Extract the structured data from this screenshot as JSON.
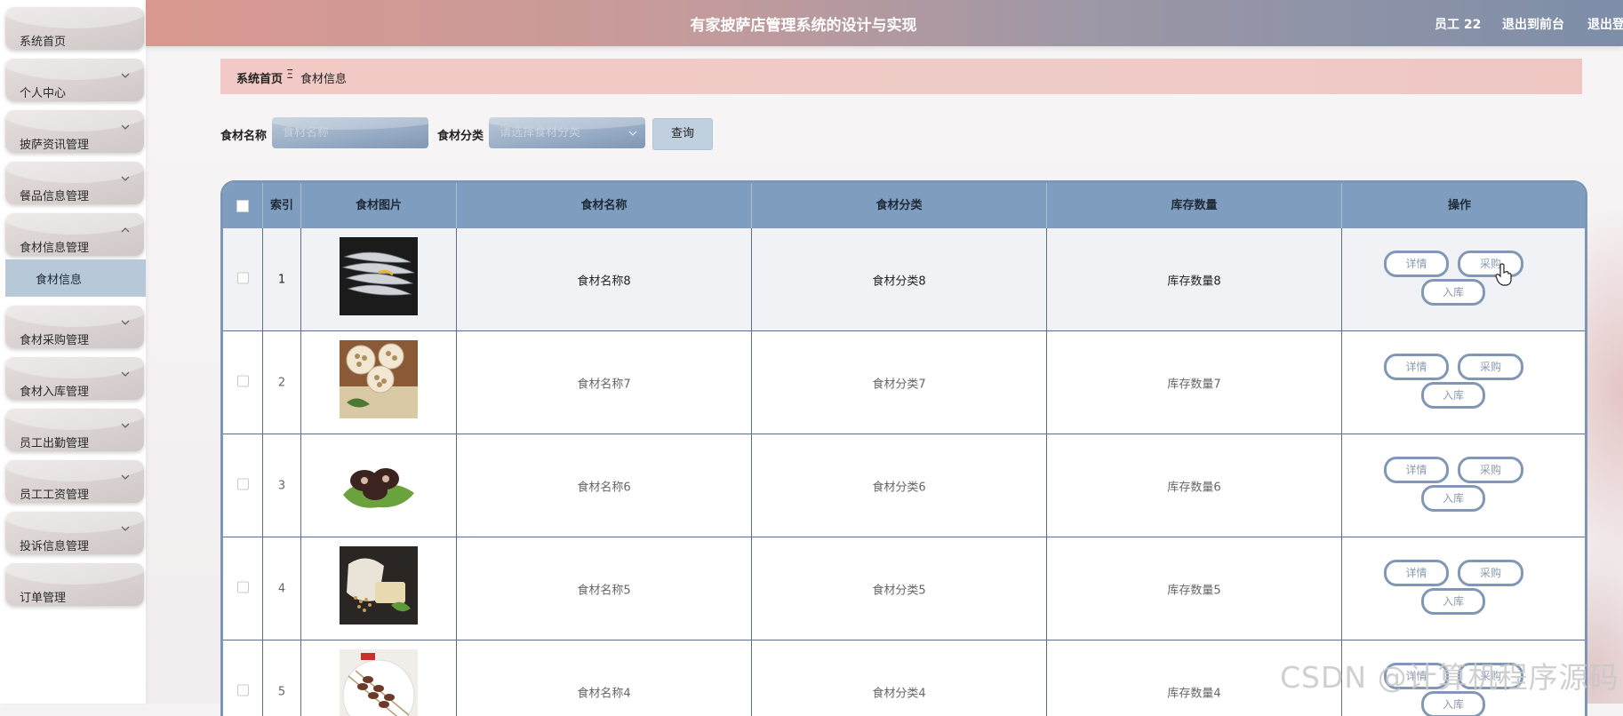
{
  "app": {
    "title": "有家披萨店管理系统的设计与实现",
    "user": "员工 22",
    "to_front": "退出到前台",
    "logout": "退出登录"
  },
  "sidebar": {
    "items": [
      {
        "label": "系统首页",
        "has_chevron": false
      },
      {
        "label": "个人中心",
        "has_chevron": true
      },
      {
        "label": "披萨资讯管理",
        "has_chevron": true
      },
      {
        "label": "餐品信息管理",
        "has_chevron": true
      },
      {
        "label": "食材信息管理",
        "has_chevron": true,
        "expanded": true
      },
      {
        "label": "食材采购管理",
        "has_chevron": true
      },
      {
        "label": "食材入库管理",
        "has_chevron": true
      },
      {
        "label": "员工出勤管理",
        "has_chevron": true
      },
      {
        "label": "员工工资管理",
        "has_chevron": true
      },
      {
        "label": "投诉信息管理",
        "has_chevron": true
      },
      {
        "label": "订单管理",
        "has_chevron": false
      }
    ],
    "submenu": {
      "label": "食材信息",
      "active": true
    }
  },
  "breadcrumb": {
    "home": "系统首页",
    "separator": "Ξ",
    "current": "食材信息"
  },
  "search": {
    "name_label": "食材名称",
    "name_placeholder": "食材名称",
    "name_value": "",
    "category_label": "食材分类",
    "category_placeholder": "请选择食材分类",
    "query_button": "查询"
  },
  "table": {
    "columns": [
      "索引",
      "食材图片",
      "食材名称",
      "食材分类",
      "库存数量",
      "操作"
    ],
    "rows": [
      {
        "index": "1",
        "name": "食材名称8",
        "category": "食材分类8",
        "stock": "库存数量8",
        "image": "fish"
      },
      {
        "index": "2",
        "name": "食材名称7",
        "category": "食材分类7",
        "stock": "库存数量7",
        "image": "lotus-root"
      },
      {
        "index": "3",
        "name": "食材名称6",
        "category": "食材分类6",
        "stock": "库存数量6",
        "image": "shiitake"
      },
      {
        "index": "4",
        "name": "食材名称5",
        "category": "食材分类5",
        "stock": "库存数量5",
        "image": "grains"
      },
      {
        "index": "5",
        "name": "食材名称4",
        "category": "食材分类4",
        "stock": "库存数量4",
        "image": "skewers"
      }
    ],
    "actions": {
      "detail": "详情",
      "purchase": "采购",
      "stock_in": "入库"
    }
  },
  "watermark": "CSDN @计算机程序源码",
  "colors": {
    "header_start": "#d9988f",
    "header_end": "#7d8ea8",
    "table_header": "#7f9dbe",
    "breadcrumb": "#f2c9c4",
    "active_submenu": "#b7c8d8"
  }
}
